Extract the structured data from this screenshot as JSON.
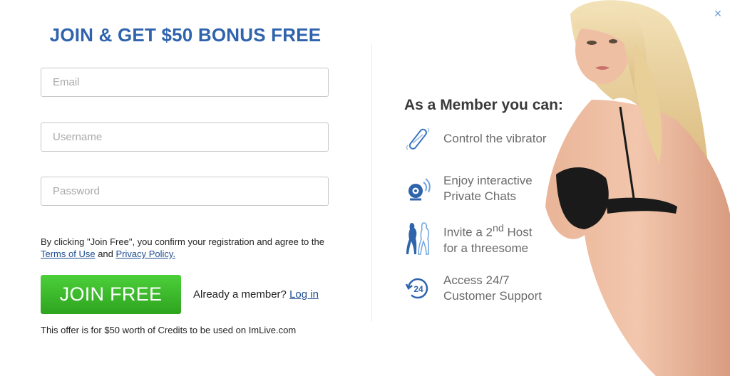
{
  "modal": {
    "title": "JOIN & GET $50 BONUS FREE",
    "close_label": "×"
  },
  "form": {
    "email_placeholder": "Email",
    "username_placeholder": "Username",
    "password_placeholder": "Password",
    "consent_prefix": "By clicking \"Join Free\", you confirm your registration and agree to the ",
    "terms_label": "Terms of Use",
    "consent_and": " and ",
    "privacy_label": "Privacy Policy.",
    "join_label": "JOIN FREE",
    "already_member": "Already a member? ",
    "login_label": "Log in",
    "offer_text": "This offer is for $50 worth of Credits to be used on ImLive.com"
  },
  "benefits": {
    "title": "As a Member you can:",
    "items": [
      {
        "icon": "vibrator-icon",
        "line1": "Control the vibrator",
        "line2": ""
      },
      {
        "icon": "webcam-icon",
        "line1": "Enjoy interactive",
        "line2": "Private Chats"
      },
      {
        "icon": "two-hosts-icon",
        "line1": "Invite a 2",
        "sup": "nd",
        "line1_after": " Host",
        "line2": "for a threesome"
      },
      {
        "icon": "support-24-icon",
        "line1": "Access 24/7",
        "line2": "Customer Support"
      }
    ]
  },
  "colors": {
    "title_blue": "#2f64ad",
    "join_green": "#3bba2b",
    "link_blue": "#1f4e8f",
    "icon_blue": "#3b78c4"
  }
}
